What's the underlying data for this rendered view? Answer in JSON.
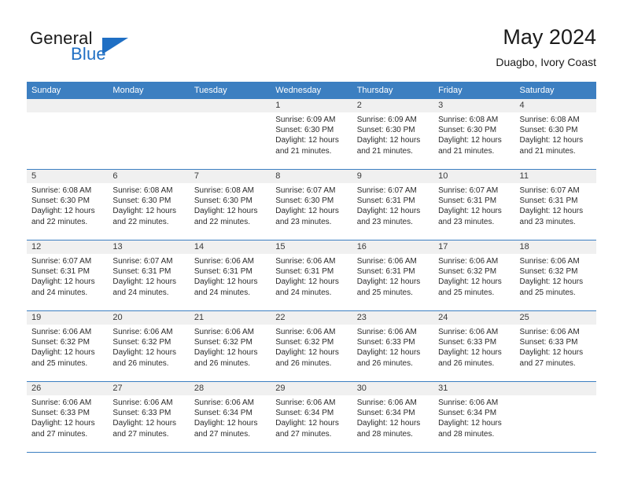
{
  "brand": {
    "name_top": "General",
    "name_bottom": "Blue",
    "accent_color": "#1f6fc4"
  },
  "header": {
    "title": "May 2024",
    "subtitle": "Duagbo, Ivory Coast"
  },
  "calendar": {
    "header_color": "#3c7fc1",
    "daynum_band_color": "#f0f0f0",
    "weekdays": [
      "Sunday",
      "Monday",
      "Tuesday",
      "Wednesday",
      "Thursday",
      "Friday",
      "Saturday"
    ],
    "weeks": [
      [
        {
          "day": "",
          "sunrise": "",
          "sunset": "",
          "daylight1": "",
          "daylight2": ""
        },
        {
          "day": "",
          "sunrise": "",
          "sunset": "",
          "daylight1": "",
          "daylight2": ""
        },
        {
          "day": "",
          "sunrise": "",
          "sunset": "",
          "daylight1": "",
          "daylight2": ""
        },
        {
          "day": "1",
          "sunrise": "Sunrise: 6:09 AM",
          "sunset": "Sunset: 6:30 PM",
          "daylight1": "Daylight: 12 hours",
          "daylight2": "and 21 minutes."
        },
        {
          "day": "2",
          "sunrise": "Sunrise: 6:09 AM",
          "sunset": "Sunset: 6:30 PM",
          "daylight1": "Daylight: 12 hours",
          "daylight2": "and 21 minutes."
        },
        {
          "day": "3",
          "sunrise": "Sunrise: 6:08 AM",
          "sunset": "Sunset: 6:30 PM",
          "daylight1": "Daylight: 12 hours",
          "daylight2": "and 21 minutes."
        },
        {
          "day": "4",
          "sunrise": "Sunrise: 6:08 AM",
          "sunset": "Sunset: 6:30 PM",
          "daylight1": "Daylight: 12 hours",
          "daylight2": "and 21 minutes."
        }
      ],
      [
        {
          "day": "5",
          "sunrise": "Sunrise: 6:08 AM",
          "sunset": "Sunset: 6:30 PM",
          "daylight1": "Daylight: 12 hours",
          "daylight2": "and 22 minutes."
        },
        {
          "day": "6",
          "sunrise": "Sunrise: 6:08 AM",
          "sunset": "Sunset: 6:30 PM",
          "daylight1": "Daylight: 12 hours",
          "daylight2": "and 22 minutes."
        },
        {
          "day": "7",
          "sunrise": "Sunrise: 6:08 AM",
          "sunset": "Sunset: 6:30 PM",
          "daylight1": "Daylight: 12 hours",
          "daylight2": "and 22 minutes."
        },
        {
          "day": "8",
          "sunrise": "Sunrise: 6:07 AM",
          "sunset": "Sunset: 6:30 PM",
          "daylight1": "Daylight: 12 hours",
          "daylight2": "and 23 minutes."
        },
        {
          "day": "9",
          "sunrise": "Sunrise: 6:07 AM",
          "sunset": "Sunset: 6:31 PM",
          "daylight1": "Daylight: 12 hours",
          "daylight2": "and 23 minutes."
        },
        {
          "day": "10",
          "sunrise": "Sunrise: 6:07 AM",
          "sunset": "Sunset: 6:31 PM",
          "daylight1": "Daylight: 12 hours",
          "daylight2": "and 23 minutes."
        },
        {
          "day": "11",
          "sunrise": "Sunrise: 6:07 AM",
          "sunset": "Sunset: 6:31 PM",
          "daylight1": "Daylight: 12 hours",
          "daylight2": "and 23 minutes."
        }
      ],
      [
        {
          "day": "12",
          "sunrise": "Sunrise: 6:07 AM",
          "sunset": "Sunset: 6:31 PM",
          "daylight1": "Daylight: 12 hours",
          "daylight2": "and 24 minutes."
        },
        {
          "day": "13",
          "sunrise": "Sunrise: 6:07 AM",
          "sunset": "Sunset: 6:31 PM",
          "daylight1": "Daylight: 12 hours",
          "daylight2": "and 24 minutes."
        },
        {
          "day": "14",
          "sunrise": "Sunrise: 6:06 AM",
          "sunset": "Sunset: 6:31 PM",
          "daylight1": "Daylight: 12 hours",
          "daylight2": "and 24 minutes."
        },
        {
          "day": "15",
          "sunrise": "Sunrise: 6:06 AM",
          "sunset": "Sunset: 6:31 PM",
          "daylight1": "Daylight: 12 hours",
          "daylight2": "and 24 minutes."
        },
        {
          "day": "16",
          "sunrise": "Sunrise: 6:06 AM",
          "sunset": "Sunset: 6:31 PM",
          "daylight1": "Daylight: 12 hours",
          "daylight2": "and 25 minutes."
        },
        {
          "day": "17",
          "sunrise": "Sunrise: 6:06 AM",
          "sunset": "Sunset: 6:32 PM",
          "daylight1": "Daylight: 12 hours",
          "daylight2": "and 25 minutes."
        },
        {
          "day": "18",
          "sunrise": "Sunrise: 6:06 AM",
          "sunset": "Sunset: 6:32 PM",
          "daylight1": "Daylight: 12 hours",
          "daylight2": "and 25 minutes."
        }
      ],
      [
        {
          "day": "19",
          "sunrise": "Sunrise: 6:06 AM",
          "sunset": "Sunset: 6:32 PM",
          "daylight1": "Daylight: 12 hours",
          "daylight2": "and 25 minutes."
        },
        {
          "day": "20",
          "sunrise": "Sunrise: 6:06 AM",
          "sunset": "Sunset: 6:32 PM",
          "daylight1": "Daylight: 12 hours",
          "daylight2": "and 26 minutes."
        },
        {
          "day": "21",
          "sunrise": "Sunrise: 6:06 AM",
          "sunset": "Sunset: 6:32 PM",
          "daylight1": "Daylight: 12 hours",
          "daylight2": "and 26 minutes."
        },
        {
          "day": "22",
          "sunrise": "Sunrise: 6:06 AM",
          "sunset": "Sunset: 6:32 PM",
          "daylight1": "Daylight: 12 hours",
          "daylight2": "and 26 minutes."
        },
        {
          "day": "23",
          "sunrise": "Sunrise: 6:06 AM",
          "sunset": "Sunset: 6:33 PM",
          "daylight1": "Daylight: 12 hours",
          "daylight2": "and 26 minutes."
        },
        {
          "day": "24",
          "sunrise": "Sunrise: 6:06 AM",
          "sunset": "Sunset: 6:33 PM",
          "daylight1": "Daylight: 12 hours",
          "daylight2": "and 26 minutes."
        },
        {
          "day": "25",
          "sunrise": "Sunrise: 6:06 AM",
          "sunset": "Sunset: 6:33 PM",
          "daylight1": "Daylight: 12 hours",
          "daylight2": "and 27 minutes."
        }
      ],
      [
        {
          "day": "26",
          "sunrise": "Sunrise: 6:06 AM",
          "sunset": "Sunset: 6:33 PM",
          "daylight1": "Daylight: 12 hours",
          "daylight2": "and 27 minutes."
        },
        {
          "day": "27",
          "sunrise": "Sunrise: 6:06 AM",
          "sunset": "Sunset: 6:33 PM",
          "daylight1": "Daylight: 12 hours",
          "daylight2": "and 27 minutes."
        },
        {
          "day": "28",
          "sunrise": "Sunrise: 6:06 AM",
          "sunset": "Sunset: 6:34 PM",
          "daylight1": "Daylight: 12 hours",
          "daylight2": "and 27 minutes."
        },
        {
          "day": "29",
          "sunrise": "Sunrise: 6:06 AM",
          "sunset": "Sunset: 6:34 PM",
          "daylight1": "Daylight: 12 hours",
          "daylight2": "and 27 minutes."
        },
        {
          "day": "30",
          "sunrise": "Sunrise: 6:06 AM",
          "sunset": "Sunset: 6:34 PM",
          "daylight1": "Daylight: 12 hours",
          "daylight2": "and 28 minutes."
        },
        {
          "day": "31",
          "sunrise": "Sunrise: 6:06 AM",
          "sunset": "Sunset: 6:34 PM",
          "daylight1": "Daylight: 12 hours",
          "daylight2": "and 28 minutes."
        },
        {
          "day": "",
          "sunrise": "",
          "sunset": "",
          "daylight1": "",
          "daylight2": ""
        }
      ]
    ]
  }
}
